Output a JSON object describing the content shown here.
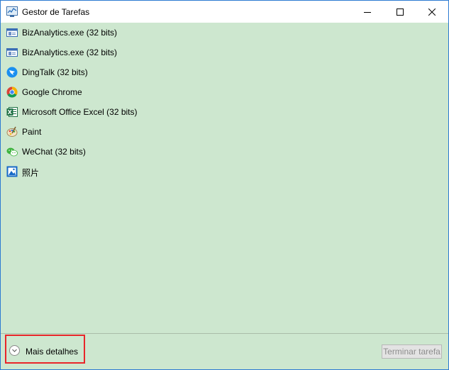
{
  "window": {
    "title": "Gestor de Tarefas",
    "controls": [
      "minimize",
      "maximize",
      "close"
    ]
  },
  "apps": [
    {
      "label": "BizAnalytics.exe (32 bits)",
      "icon": "window-app-icon"
    },
    {
      "label": "BizAnalytics.exe (32 bits)",
      "icon": "window-app-icon"
    },
    {
      "label": "DingTalk (32 bits)",
      "icon": "dingtalk-icon"
    },
    {
      "label": "Google Chrome",
      "icon": "chrome-icon"
    },
    {
      "label": "Microsoft Office Excel (32 bits)",
      "icon": "excel-icon"
    },
    {
      "label": "Paint",
      "icon": "paint-icon"
    },
    {
      "label": "WeChat (32 bits)",
      "icon": "wechat-icon"
    },
    {
      "label": "照片",
      "icon": "photos-icon"
    }
  ],
  "footer": {
    "details_label": "Mais detalhes",
    "end_task_label": "Terminar tarefa"
  },
  "colors": {
    "background": "#cde7cf",
    "titlebar": "#ffffff",
    "highlight_border": "#e8262a"
  }
}
